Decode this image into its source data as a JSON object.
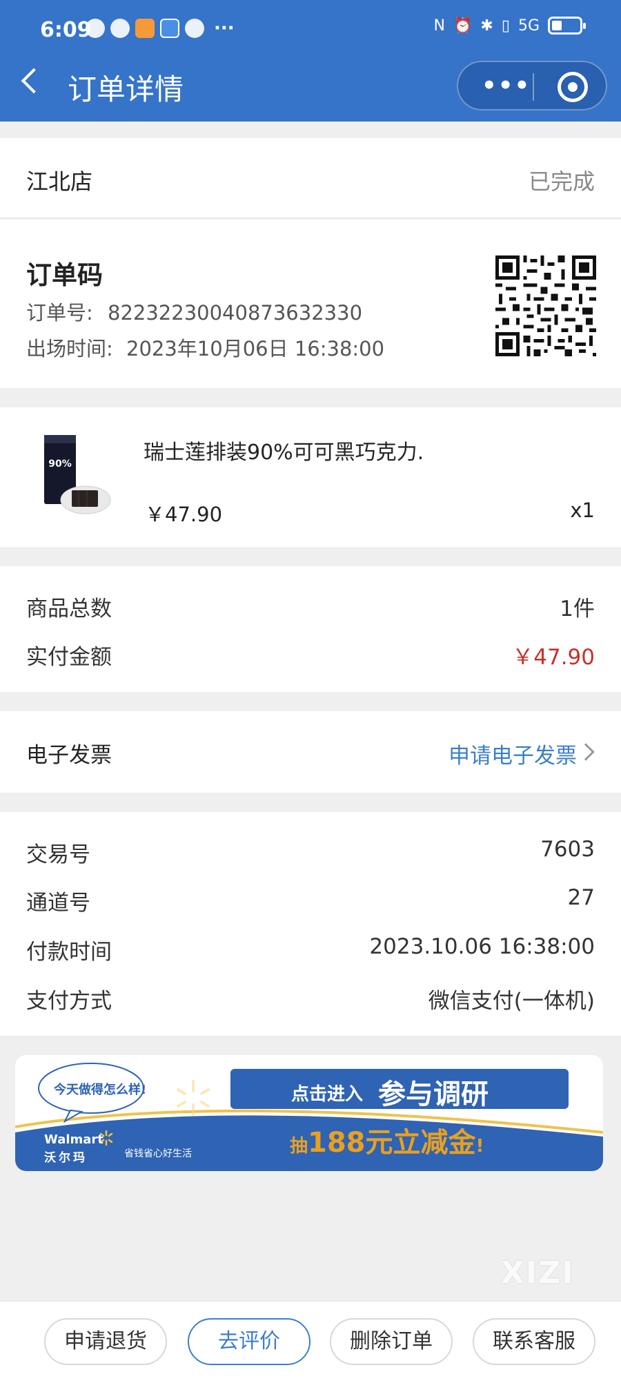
{
  "status_bar": {
    "time": "6:09",
    "more_icons": "···",
    "network": "5G"
  },
  "header": {
    "title": "订单详情",
    "capsule_more": "•••"
  },
  "store": {
    "name": "江北店",
    "status": "已完成"
  },
  "order": {
    "code_title": "订单码",
    "order_no_label": "订单号:",
    "order_no": "82232230040873632330",
    "exit_time_label": "出场时间:",
    "exit_time": "2023年10月06日 16:38:00"
  },
  "product": {
    "name": "瑞士莲排装90%可可黑巧克力.",
    "price": "￥47.90",
    "qty": "x1",
    "image_text": "90%"
  },
  "summary": {
    "total_count_label": "商品总数",
    "total_count": "1件",
    "paid_label": "实付金额",
    "paid": "￥47.90"
  },
  "invoice": {
    "label": "电子发票",
    "link": "申请电子发票"
  },
  "transaction": {
    "trade_no_label": "交易号",
    "trade_no": "7603",
    "channel_label": "通道号",
    "channel": "27",
    "pay_time_label": "付款时间",
    "pay_time": "2023.10.06 16:38:00",
    "pay_method_label": "支付方式",
    "pay_method": "微信支付(一体机)"
  },
  "banner": {
    "bubble": "今天做得怎么样!",
    "cta_small": "点击进入",
    "cta_big": "参与调研",
    "prize_pre": "抽",
    "prize": "188元立减金",
    "prize_post": "!",
    "brand_en": "Walmart",
    "brand_cn": "沃尔玛",
    "slogan": "省钱省心好生活"
  },
  "watermark": "XIZI",
  "actions": {
    "refund": "申请退货",
    "review": "去评价",
    "delete": "删除订单",
    "service": "联系客服"
  },
  "colors": {
    "header_blue": "#3574c8",
    "price_red": "#c6312b",
    "link_blue": "#3b7fc8"
  }
}
